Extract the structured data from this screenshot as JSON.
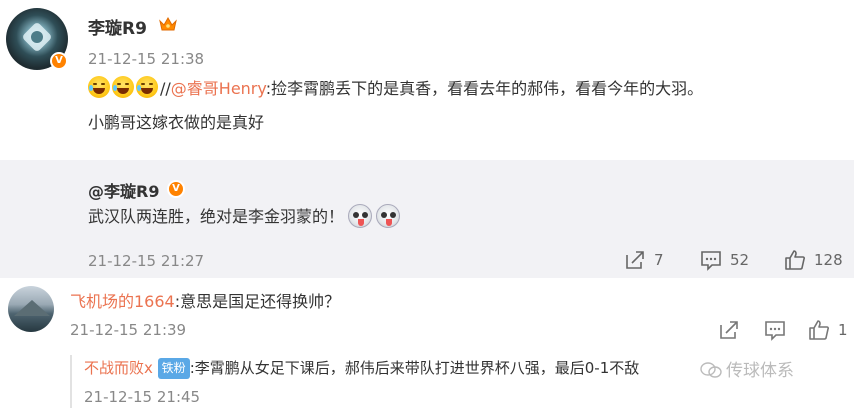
{
  "post": {
    "username": "李璇R9",
    "time": "21-12-15 21:38",
    "mention": "@睿哥Henry",
    "text_after_mention": ":捡李霄鹏丢下的是真香，看看去年的郝伟，看看今年的大羽。",
    "text_line2": "小鹏哥这嫁衣做的是真好",
    "emoji_count": 3,
    "separator": "//"
  },
  "quote": {
    "username": "@李璇R9",
    "text": "武汉队两连胜，绝对是李金羽蒙的！",
    "time": "21-12-15 21:27",
    "share_count": "7",
    "comment_count": "52",
    "like_count": "128"
  },
  "comment2": {
    "username": "飞机场的1664",
    "text": ":意思是国足还得换帅？",
    "time": "21-12-15 21:39",
    "like_count": "1"
  },
  "reply": {
    "username": "不战而败x",
    "badge": "铁粉",
    "text": ":李霄鹏从女足下课后，郝伟后来带队打进世界杯八强，最后0-1不敌",
    "time": "21-12-15 21:45"
  },
  "badge_symbol": "V",
  "watermark": "传球体系",
  "colors": {
    "accent": "#eb7350",
    "verified": "#ff8200",
    "iron_fan": "#5aa8e6"
  }
}
